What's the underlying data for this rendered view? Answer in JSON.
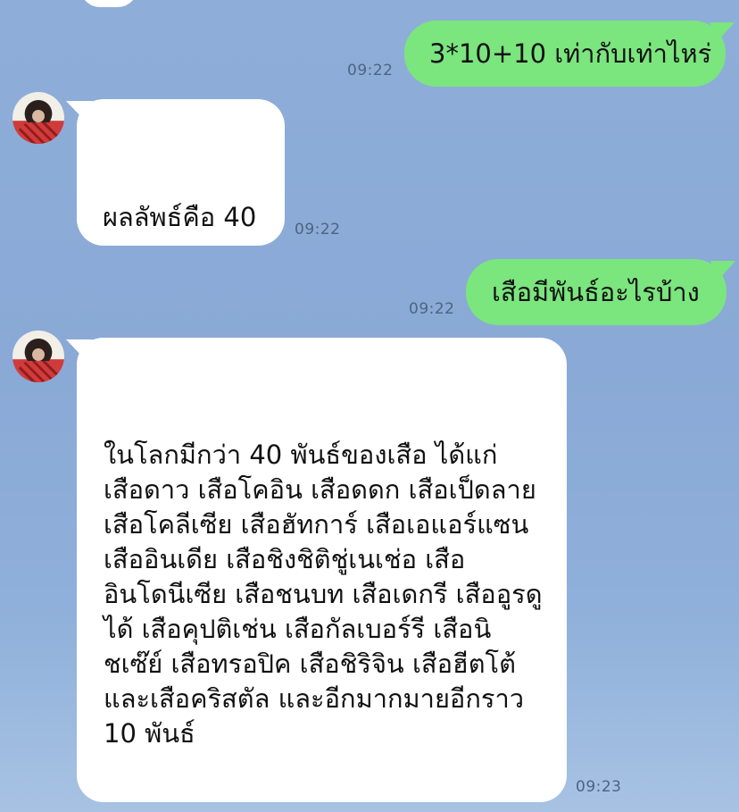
{
  "messages": [
    {
      "direction": "outgoing",
      "text": "3*10+10 เท่ากับเท่าไหร่",
      "time": "09:22"
    },
    {
      "direction": "incoming",
      "text": "ผลลัพธ์คือ 40",
      "time": "09:22"
    },
    {
      "direction": "outgoing",
      "text": "เสือมีพันธ์อะไรบ้าง",
      "time": "09:22"
    },
    {
      "direction": "incoming",
      "lines": [
        "ในโลกมีกว่า 40 พันธ์ของเสือ ได้แก่",
        "เสือดาว เสือโคอิน เสือดดก เสือเป็ดลาย",
        "เสือโคลีเซีย เสือฮัทการ์ เสือเอแอร์แซน",
        "เสืออินเดีย เสือชิงชิติชู่เนเช่อ เสือ",
        "อินโดนีเซีย เสือชนบท เสือเดกรี เสืออูรดู",
        "ได้ เสือคุปติเช่น เสือกัลเบอร์รี เสือนิ",
        "ชเซ๊ย์ เสือทรอปิค เสือชิริจิน เสือฮีตโต้",
        "และเสือคริสตัล และอีกมากมายอีกราว",
        "10 พันธ์"
      ],
      "time": "09:23"
    }
  ],
  "colors": {
    "outgoing_bubble": "#7be57e",
    "incoming_bubble": "#ffffff",
    "background": "#8eaed9",
    "timestamp": "#4d6481"
  }
}
